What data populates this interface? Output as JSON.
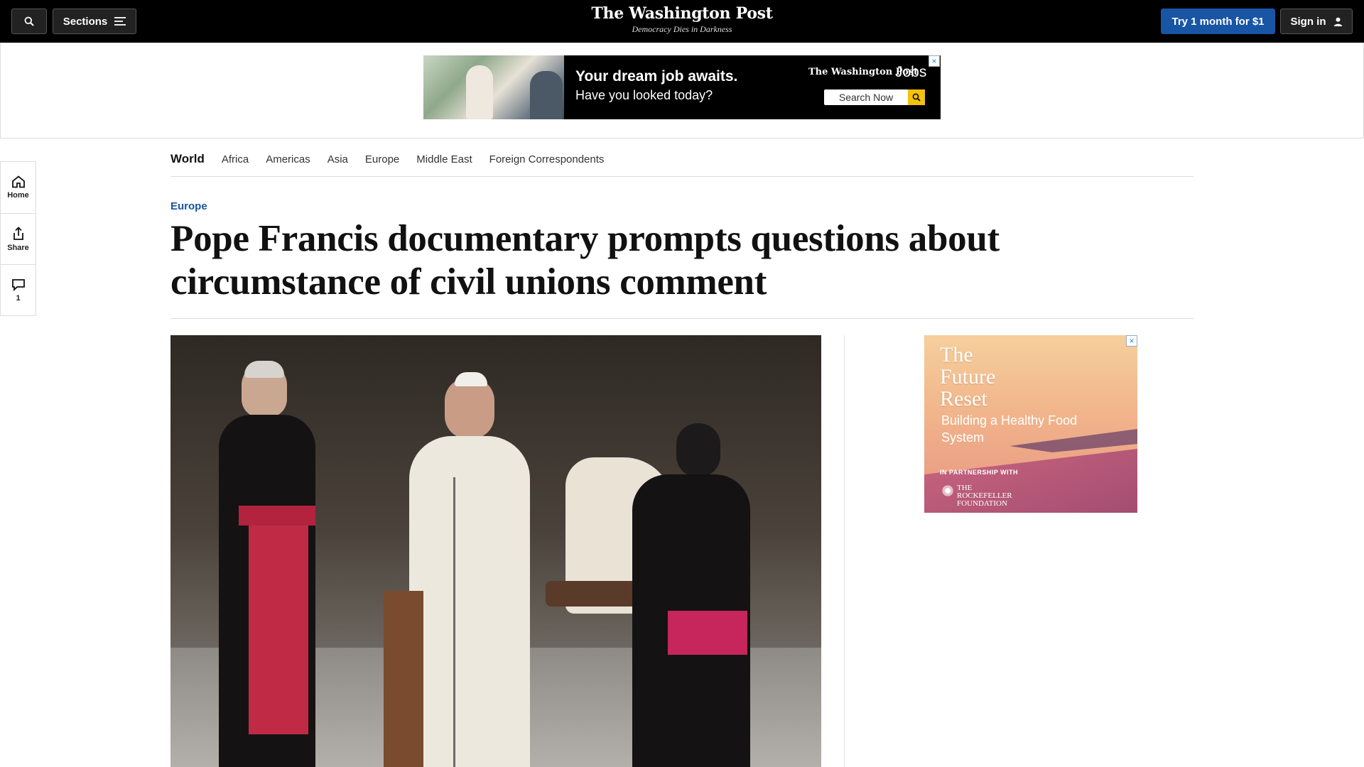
{
  "header": {
    "sections_label": "Sections",
    "logo": "The Washington Post",
    "tagline": "Democracy Dies in Darkness",
    "subscribe_label": "Try 1 month for $1",
    "signin_label": "Sign in"
  },
  "top_ad": {
    "headline": "Your dream job awaits.",
    "subhead": "Have you looked today?",
    "brand": "The Washington Post",
    "brand_suffix": "Jobs",
    "search_label": "Search Now"
  },
  "rail": {
    "home_label": "Home",
    "share_label": "Share",
    "comment_count": "1"
  },
  "section_nav": {
    "current": "World",
    "items": [
      "Africa",
      "Americas",
      "Asia",
      "Europe",
      "Middle East",
      "Foreign Correspondents"
    ]
  },
  "article": {
    "kicker": "Europe",
    "headline": "Pope Francis documentary prompts questions about circumstance of civil unions comment"
  },
  "side_ad": {
    "title": "The Future Reset",
    "subtitle": "Building a Healthy Food System",
    "partnership": "IN PARTNERSHIP WITH",
    "sponsor": "THE ROCKEFELLER FOUNDATION"
  },
  "colors": {
    "brand_blue": "#1955a5",
    "header_bg": "#000000",
    "ad_close": "#1a8fd4"
  }
}
